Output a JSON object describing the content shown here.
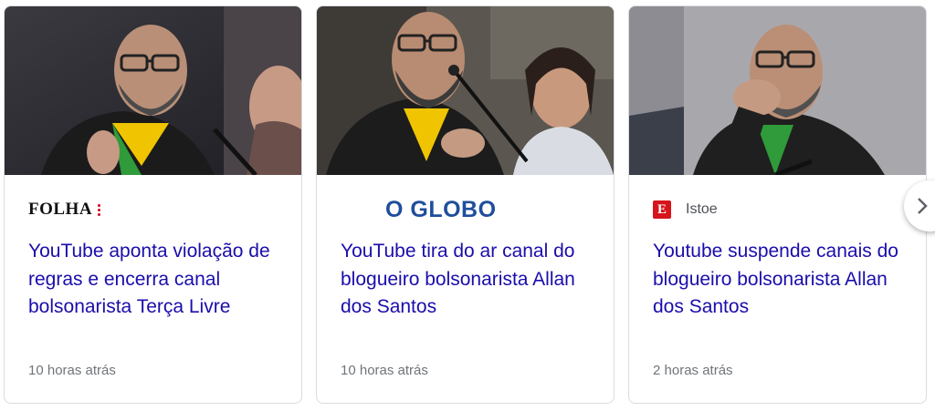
{
  "cards": [
    {
      "source": "FOLHA",
      "headline": "YouTube aponta violação de regras e encerra canal bolsonarista Terça Livre",
      "time": "10 horas atrás"
    },
    {
      "source": "O GLOBO",
      "headline": "YouTube tira do ar canal do blogueiro bolsonarista Allan dos Santos",
      "time": "10 horas atrás"
    },
    {
      "source_badge": "E",
      "source": "Istoe",
      "headline": "Youtube suspende canais do blogueiro bolsonarista Allan dos Santos",
      "time": "2 horas atrás"
    }
  ],
  "colors": {
    "headline": "#1a0dab",
    "time": "#70757a",
    "border": "#dadce0",
    "globo_blue": "#1f4e9c",
    "istoe_red": "#d6141c"
  },
  "next_button_icon": "chevron-right-icon"
}
